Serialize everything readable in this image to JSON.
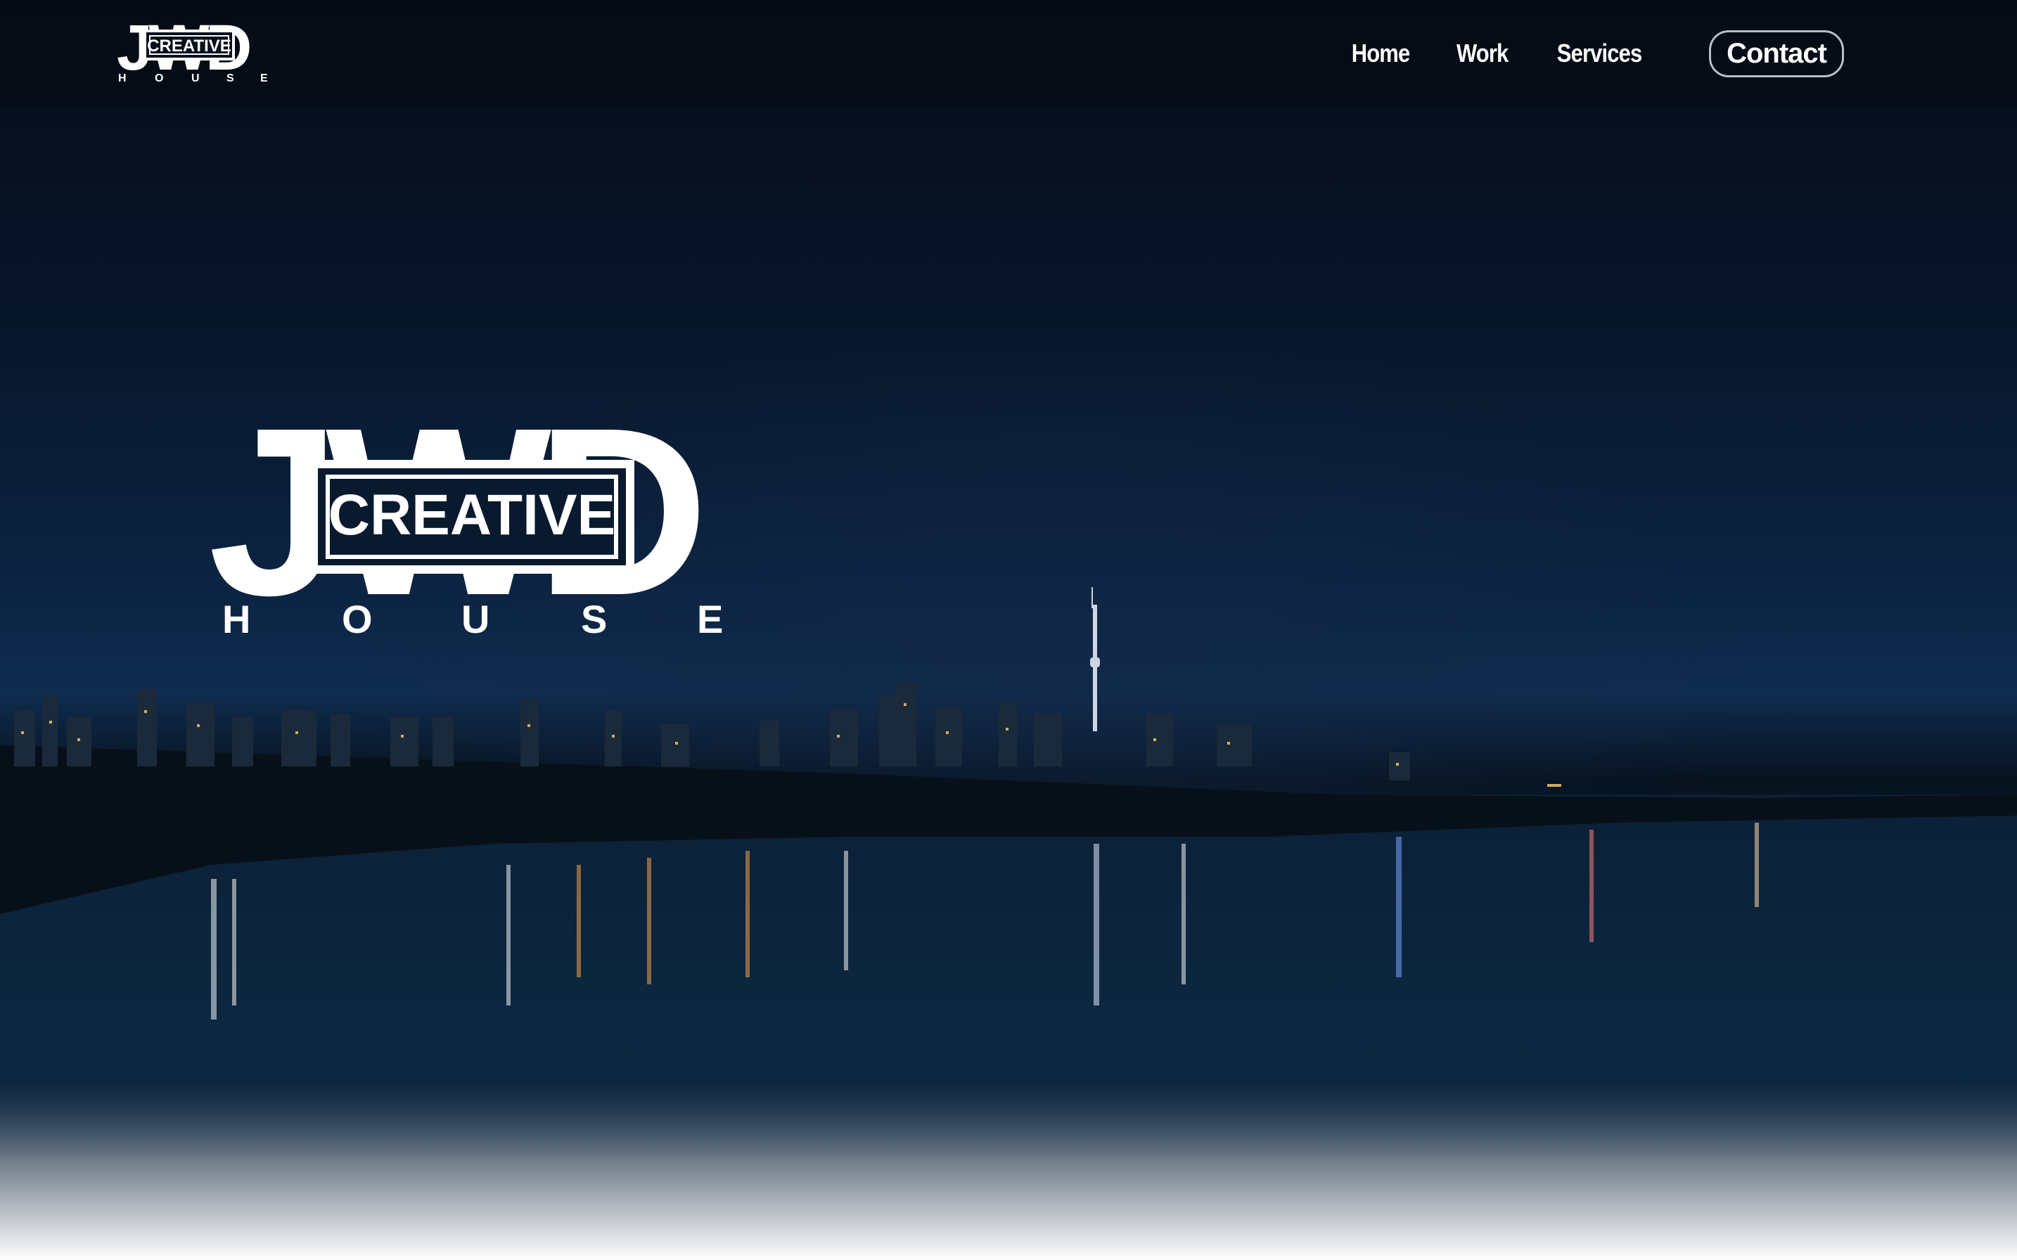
{
  "brand": {
    "top_letters": "JWD",
    "box_word": "CREATIVE",
    "sub_word": "HOUSE",
    "sub_letters": [
      "H",
      "O",
      "U",
      "S",
      "E"
    ]
  },
  "hero_logo": {
    "top_letters": "JWD",
    "box_word": "CREATIVE",
    "sub_letters": [
      "H",
      "O",
      "U",
      "S",
      "E"
    ]
  },
  "nav": {
    "items": [
      {
        "label": "Home"
      },
      {
        "label": "Work"
      },
      {
        "label": "Services"
      }
    ],
    "contact_label": "Contact"
  },
  "hero": {
    "image_description_icon": "city-skyline-at-night"
  },
  "colors": {
    "logo": "#ffffff",
    "nav_text": "#ffffff",
    "contact_border": "#b9bec6",
    "sky_top": "#050b16",
    "sky_mid": "#0f2c4f",
    "water_fade": "#ffffff"
  }
}
